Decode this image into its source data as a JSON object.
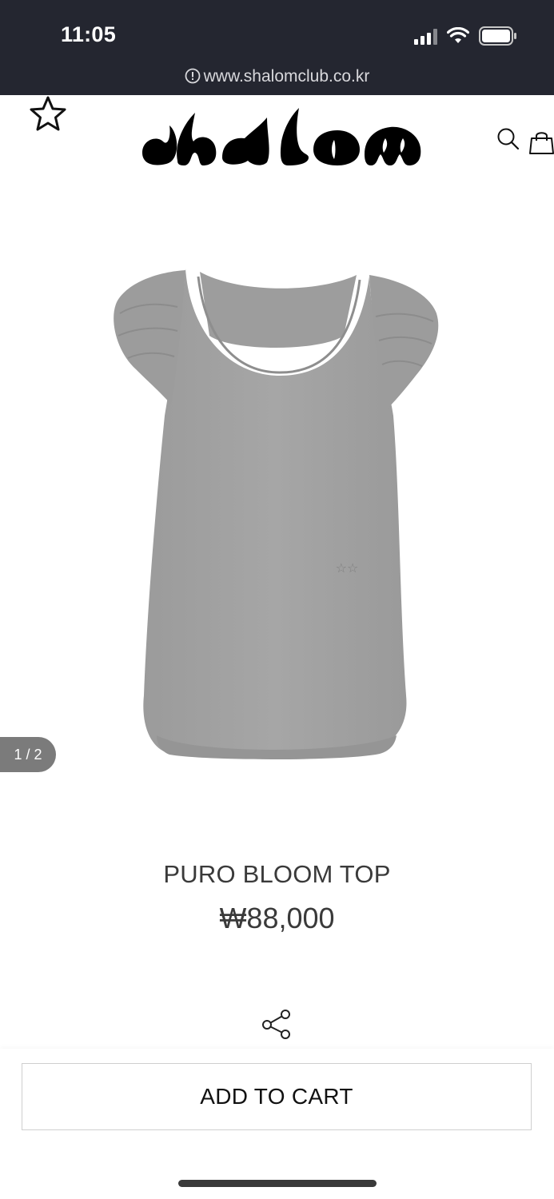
{
  "status_bar": {
    "time": "11:05"
  },
  "browser": {
    "url": "www.shalomclub.co.kr"
  },
  "header": {
    "logo_text": "shalom"
  },
  "product": {
    "pager": "1 / 2",
    "name": "PURO BLOOM TOP",
    "price": "₩88,000"
  },
  "actions": {
    "add_to_cart": "ADD TO CART"
  },
  "icons": {
    "wishlist": "star-icon",
    "search": "search-icon",
    "cart": "shopping-bag-icon",
    "share": "share-icon"
  },
  "colors": {
    "topbar": "#242630",
    "product_gray": "#a3a3a3"
  }
}
